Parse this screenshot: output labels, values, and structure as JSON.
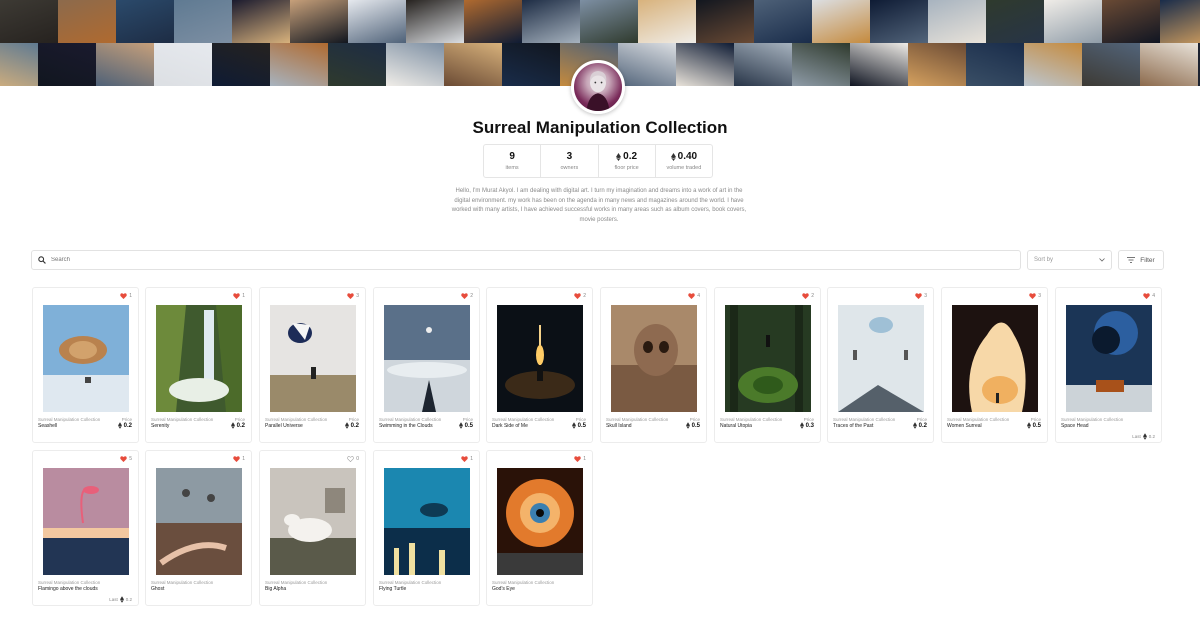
{
  "collection": {
    "title": "Surreal Manipulation Collection",
    "description": "Hello, I'm Murat Akyol. I am dealing with digital art. I turn my imagination and dreams into a work of art in the digital environment. my work has been on the agenda in many news and magazines around the world. I have worked with many artists, I have achieved successful works in many areas such as album covers, book covers, movie posters."
  },
  "stats": [
    {
      "value": "9",
      "label": "items"
    },
    {
      "value": "3",
      "label": "owners"
    },
    {
      "value": "0.2",
      "label": "floor price"
    },
    {
      "value": "0.40",
      "label": "volume traded"
    }
  ],
  "toolbar": {
    "search_placeholder": "Search",
    "sort_label": "Sort by",
    "filter_label": "Filter"
  },
  "icons": {
    "heart": "heart-icon",
    "eth": "ethereum-icon",
    "search": "search-icon",
    "chevron": "chevron-down-icon",
    "filter": "filter-icon"
  },
  "colors": {
    "heart_filled": "#e74c3c",
    "heart_outline": "#999999"
  },
  "items": [
    {
      "collection": "Surreal Manipulation Collection",
      "name": "Seashell",
      "likes": "1",
      "liked": true,
      "price_label": "Price",
      "price": "0.2"
    },
    {
      "collection": "Surreal Manipulation Collection",
      "name": "Serenity",
      "likes": "1",
      "liked": true,
      "price_label": "Price",
      "price": "0.2"
    },
    {
      "collection": "Surreal Manipulation Collection",
      "name": "Parallel Universe",
      "likes": "3",
      "liked": true,
      "price_label": "Price",
      "price": "0.2"
    },
    {
      "collection": "Surreal Manipulation Collection",
      "name": "Swimming in the Clouds",
      "likes": "2",
      "liked": true,
      "price_label": "Price",
      "price": "0.5"
    },
    {
      "collection": "Surreal Manipulation Collection",
      "name": "Dark Side of Me",
      "likes": "2",
      "liked": true,
      "price_label": "Price",
      "price": "0.5"
    },
    {
      "collection": "Surreal Manipulation Collection",
      "name": "Skull Island",
      "likes": "4",
      "liked": true,
      "price_label": "Price",
      "price": "0.5"
    },
    {
      "collection": "Surreal Manipulation Collection",
      "name": "Natural Utopia",
      "likes": "2",
      "liked": true,
      "price_label": "Price",
      "price": "0.3"
    },
    {
      "collection": "Surreal Manipulation Collection",
      "name": "Traces of the Past",
      "likes": "3",
      "liked": true,
      "price_label": "Price",
      "price": "0.2"
    },
    {
      "collection": "Surreal Manipulation Collection",
      "name": "Women Surreal",
      "likes": "3",
      "liked": true,
      "price_label": "Price",
      "price": "0.5"
    },
    {
      "collection": "Surreal Manipulation Collection",
      "name": "Space Head",
      "likes": "4",
      "liked": true,
      "last_label": "Last",
      "last": "0.2"
    },
    {
      "collection": "Surreal Manipulation Collection",
      "name": "Flamingo above the clouds",
      "likes": "5",
      "liked": true,
      "last_label": "Last",
      "last": "0.2"
    },
    {
      "collection": "Surreal Manipulation Collection",
      "name": "Ghost",
      "likes": "1",
      "liked": true
    },
    {
      "collection": "Surreal Manipulation Collection",
      "name": "Big Alpha",
      "likes": "0",
      "liked": false
    },
    {
      "collection": "Surreal Manipulation Collection",
      "name": "Flying Turtle",
      "likes": "1",
      "liked": true
    },
    {
      "collection": "Surreal Manipulation Collection",
      "name": "God's Eye",
      "likes": "1",
      "liked": true
    }
  ]
}
